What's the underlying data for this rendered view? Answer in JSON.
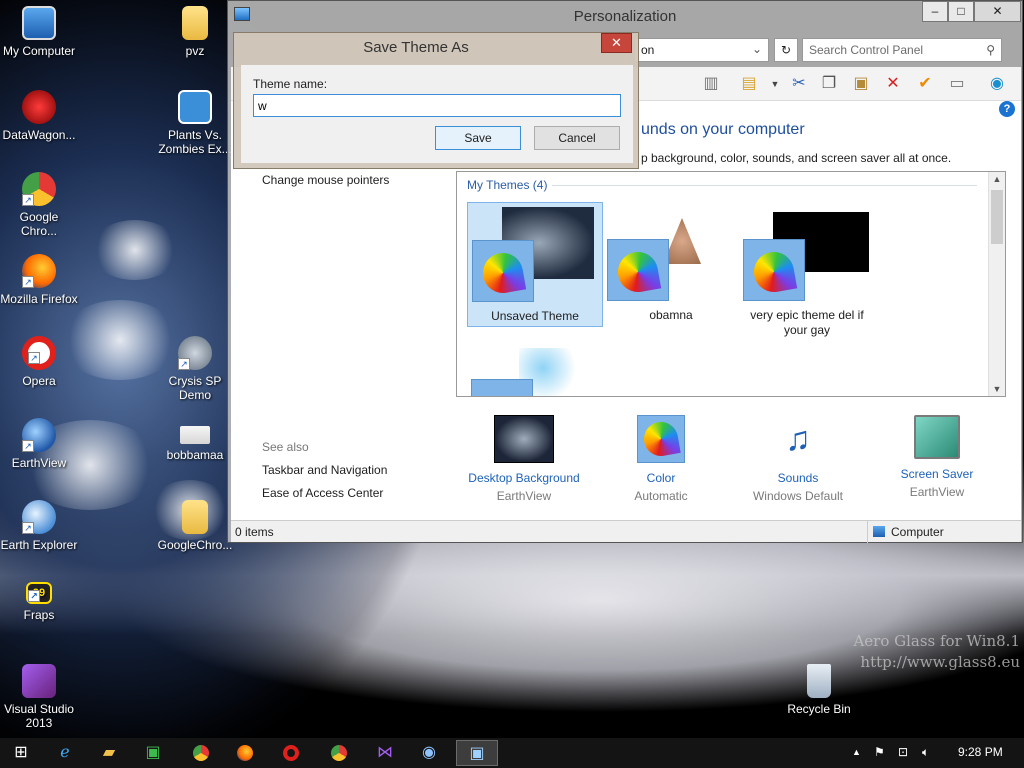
{
  "desktop": {
    "icons": [
      {
        "label": "My Computer"
      },
      {
        "label": "pvz"
      },
      {
        "label": "DataWagon..."
      },
      {
        "label": "Plants Vs. Zombies Ex..."
      },
      {
        "label": "Google Chro..."
      },
      {
        "label": "Mozilla Firefox"
      },
      {
        "label": "Opera"
      },
      {
        "label": "Crysis SP Demo"
      },
      {
        "label": "EarthView"
      },
      {
        "label": "bobbamaa"
      },
      {
        "label": "Earth Explorer"
      },
      {
        "label": "GoogleChro..."
      },
      {
        "label": "Fraps"
      },
      {
        "label": "Visual Studio 2013"
      },
      {
        "label": "Recycle Bin"
      }
    ],
    "watermark_line1": "Aero Glass for Win8.1",
    "watermark_line2": "http://www.glass8.eu"
  },
  "window": {
    "title": "Personalization",
    "address_text": "on",
    "search_placeholder": "Search Control Panel",
    "heading": "unds on your computer",
    "subheading": "p background, color, sounds, and screen saver all at once.",
    "left_links": {
      "change_mouse": "Change mouse pointers",
      "see_also": "See also",
      "taskbar": "Taskbar and Navigation",
      "ease": "Ease of Access Center"
    },
    "themes_group": "My Themes (4)",
    "themes": [
      {
        "name": "Unsaved Theme",
        "selected": true
      },
      {
        "name": "obamna",
        "selected": false
      },
      {
        "name": "very epic theme del if your gay",
        "selected": false
      }
    ],
    "bottom": [
      {
        "title": "Desktop Background",
        "value": "EarthView"
      },
      {
        "title": "Color",
        "value": "Automatic"
      },
      {
        "title": "Sounds",
        "value": "Windows Default"
      },
      {
        "title": "Screen Saver",
        "value": "EarthView"
      }
    ],
    "status_items": "0 items",
    "status_location": "Computer"
  },
  "dialog": {
    "title": "Save Theme As",
    "label": "Theme name:",
    "value": "w",
    "save": "Save",
    "cancel": "Cancel",
    "close": "✕"
  },
  "taskbar": {
    "time": "9:28 PM"
  }
}
